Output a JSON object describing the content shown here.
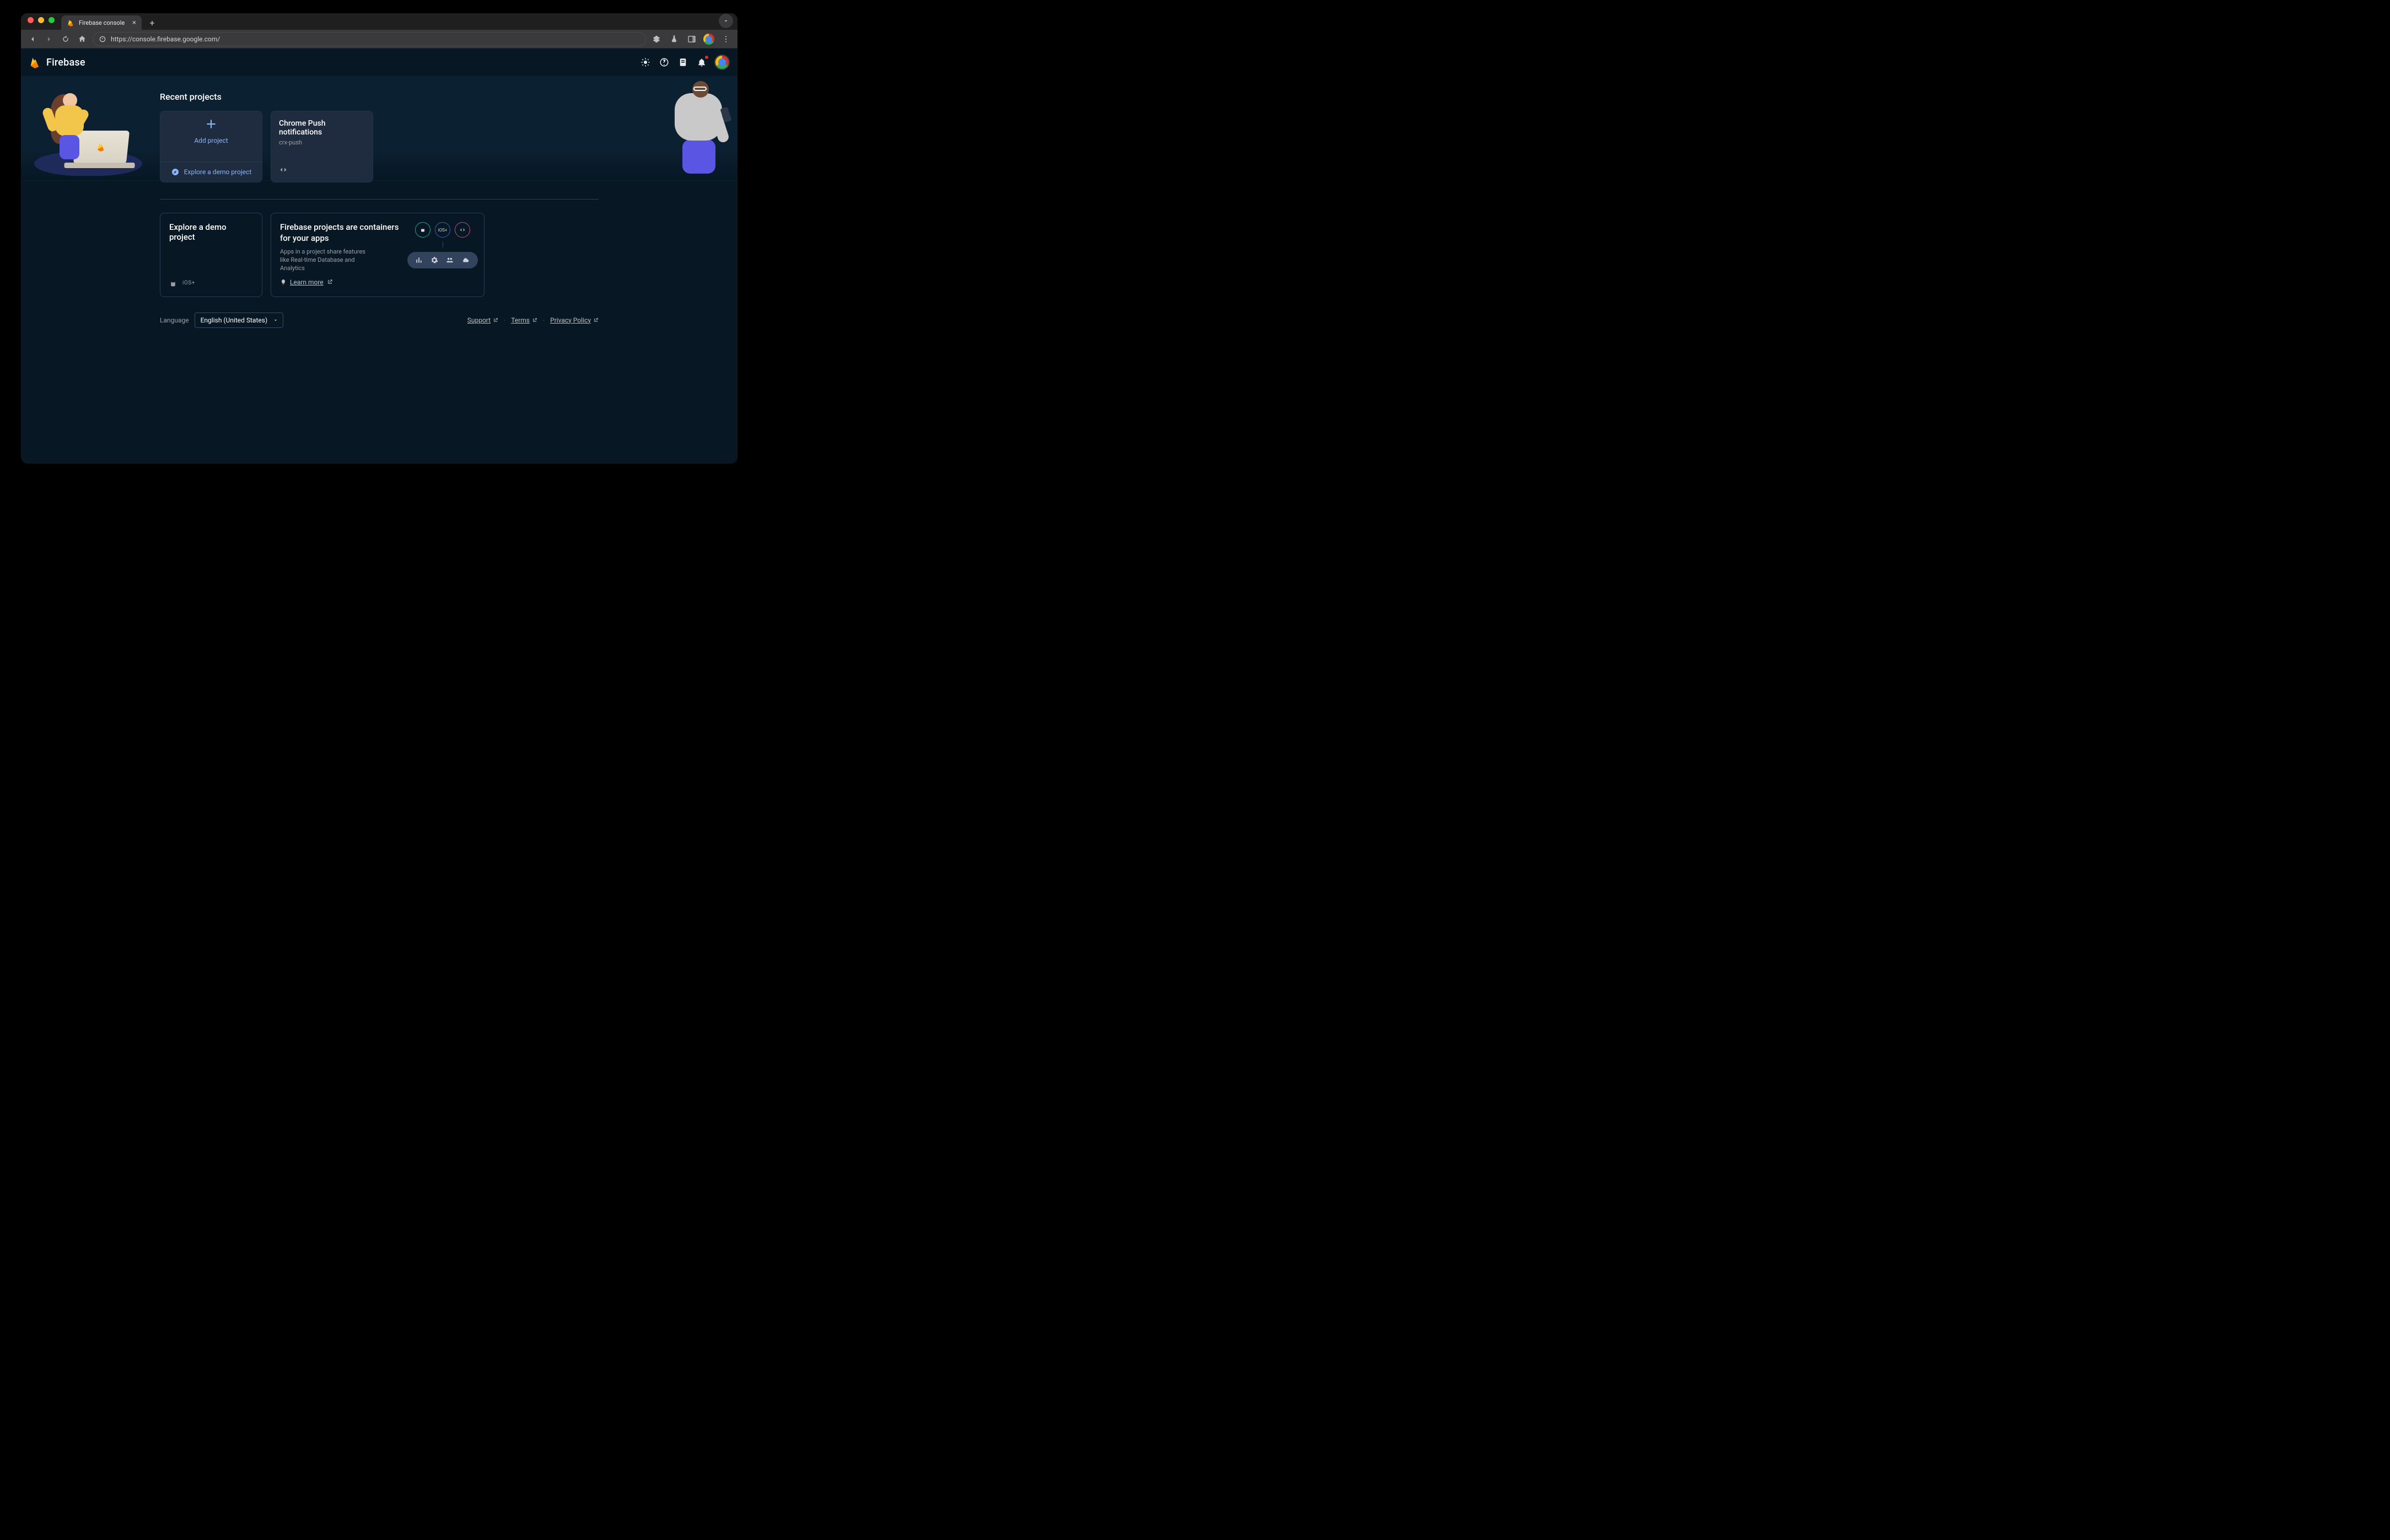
{
  "browser": {
    "tab_title": "Firebase console",
    "url": "https://console.firebase.google.com/"
  },
  "header": {
    "brand": "Firebase"
  },
  "main": {
    "recent_title": "Recent projects",
    "add_project_label": "Add project",
    "explore_demo_label": "Explore a demo project",
    "projects": [
      {
        "title": "Chrome Push notifications",
        "id": "crx-push"
      }
    ],
    "explore_card": {
      "title": "Explore a demo project"
    },
    "containers_card": {
      "title": "Firebase projects are containers for your apps",
      "desc": "Apps in a project share features like Real-time Database and Analytics",
      "learn_more": "Learn more"
    }
  },
  "footer": {
    "language_label": "Language",
    "language_value": "English (United States)",
    "links": {
      "support": "Support",
      "terms": "Terms",
      "privacy": "Privacy Policy"
    }
  }
}
